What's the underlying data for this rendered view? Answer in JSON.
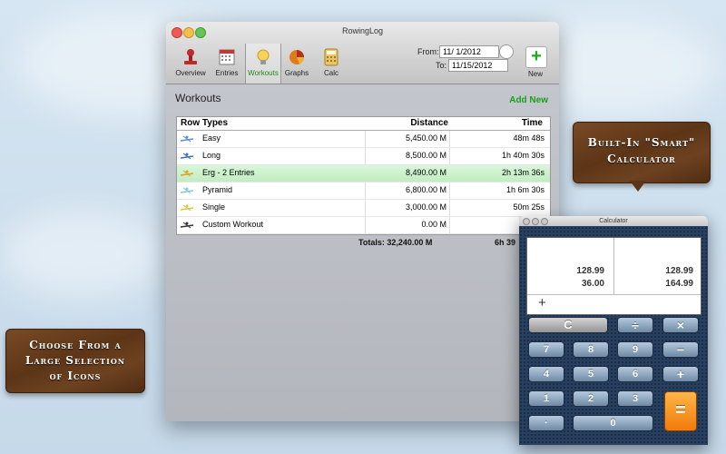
{
  "window": {
    "title": "RowingLog",
    "toolbar": [
      {
        "label": "Overview",
        "icon": "stamp-icon"
      },
      {
        "label": "Entries",
        "icon": "calendar-icon"
      },
      {
        "label": "Workouts",
        "icon": "lightbulb-icon"
      },
      {
        "label": "Graphs",
        "icon": "pie-chart-icon"
      },
      {
        "label": "Calc",
        "icon": "calculator-icon"
      }
    ],
    "selected_tool": "Workouts",
    "from_label": "From:",
    "from_value": "11/  1/2012",
    "to_label": "To:",
    "to_value": "11/15/2012",
    "new_label": "New",
    "new_symbol": "+"
  },
  "workouts": {
    "title": "Workouts",
    "add_new": "Add New",
    "columns": [
      "Row Types",
      "Distance",
      "Time"
    ],
    "rows": [
      {
        "name": "Easy",
        "distance": "5,450.00 M",
        "time": "48m 48s",
        "icon_color": "#5a8ed8"
      },
      {
        "name": "Long",
        "distance": "8,500.00 M",
        "time": "1h 40m 30s",
        "icon_color": "#3a6fc0"
      },
      {
        "name": "Erg - 2 Entries",
        "distance": "8,490.00 M",
        "time": "2h 13m 36s",
        "icon_color": "#e0a020"
      },
      {
        "name": "Pyramid",
        "distance": "6,800.00 M",
        "time": "1h 6m 30s",
        "icon_color": "#7fc9d8"
      },
      {
        "name": "Single",
        "distance": "3,000.00 M",
        "time": "50m 25s",
        "icon_color": "#d8c840"
      },
      {
        "name": "Custom Workout",
        "distance": "0.00 M",
        "time": "",
        "icon_color": "#333333"
      }
    ],
    "selected_row": 2,
    "totals_label": "Totals: 32,240.00 M",
    "totals_time": "6h 39"
  },
  "calculator": {
    "title": "Calculator",
    "display": {
      "left_top": "128.99",
      "left_bottom": "36.00",
      "right_top": "128.99",
      "right_bottom": "164.99",
      "operator": "+"
    },
    "buttons": {
      "clear": "C",
      "divide": "÷",
      "multiply": "×",
      "minus": "−",
      "plus": "+",
      "equals": "=",
      "seven": "7",
      "eight": "8",
      "nine": "9",
      "four": "4",
      "five": "5",
      "six": "6",
      "one": "1",
      "two": "2",
      "three": "3",
      "zero": "0",
      "dot": "·"
    }
  },
  "callouts": {
    "calculator": [
      "Built-In \"Smart\"",
      "Calculator"
    ],
    "icons": [
      "Choose From a",
      "Large Selection",
      "of Icons"
    ]
  },
  "colors": {
    "accent_green": "#19a019",
    "selected_row": "#c8eec8",
    "calc_orange": "#f08a12"
  }
}
